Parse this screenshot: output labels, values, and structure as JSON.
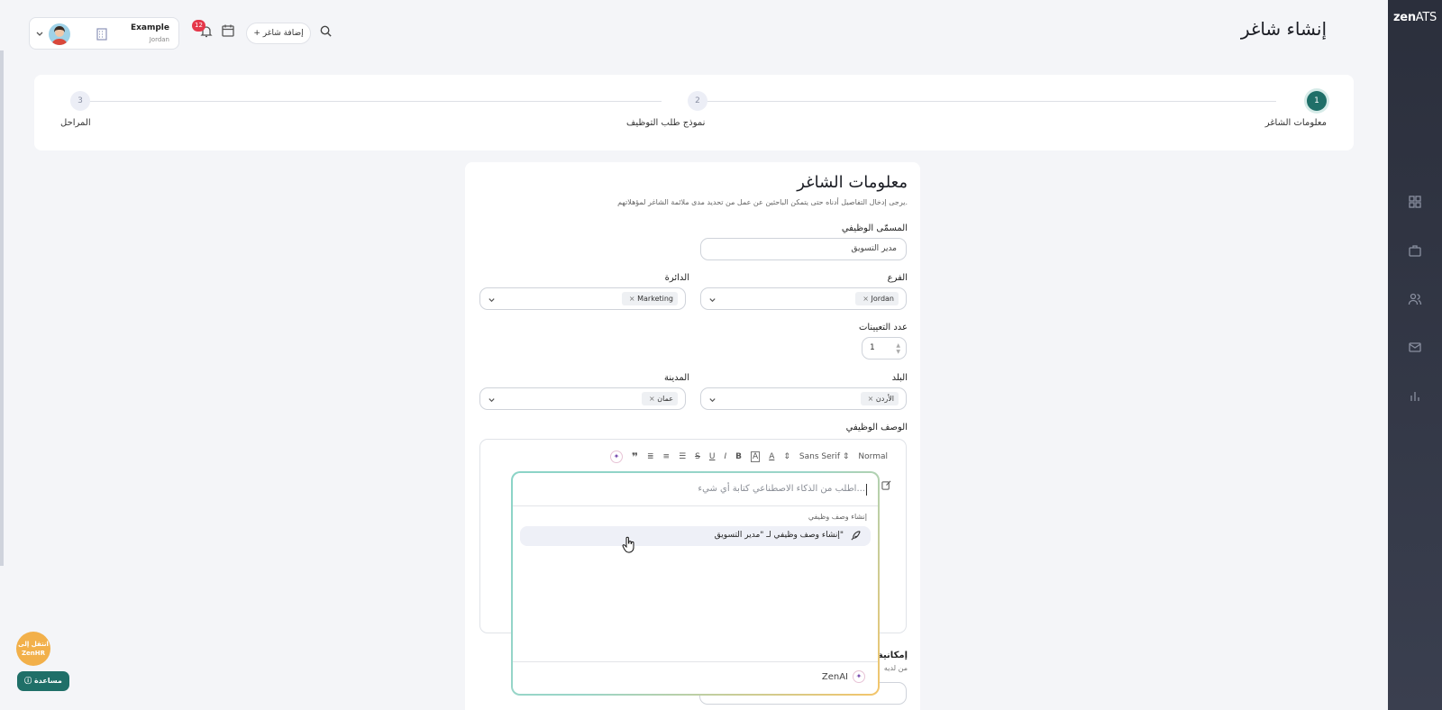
{
  "brand": {
    "zen": "zen",
    "ats": "ATS"
  },
  "header": {
    "title": "إنشاء شاغر",
    "user_name": "Example",
    "user_country": "Jordan",
    "notifications_count": "12",
    "add_job_label": "+ إضافة شاغر"
  },
  "steps": [
    {
      "number": "1",
      "label": "معلومات الشاغر",
      "active": true
    },
    {
      "number": "2",
      "label": "نموذج طلب التوظيف",
      "active": false
    },
    {
      "number": "3",
      "label": "المراحل",
      "active": false
    }
  ],
  "form": {
    "title": "معلومات الشاغر",
    "subtitle": "يرجى إدخال التفاصيل أدناه حتى يتمكن الباحثين عن عمل من تحديد مدى ملائمة الشاغر لمؤهلاتهم.",
    "job_title_label": "المسمّى الوظيفي",
    "job_title_value": "مدير التسويق",
    "branch_label": "الفرع",
    "branch_value": "Jordan",
    "department_label": "الدائرة",
    "department_value": "Marketing",
    "openings_label": "عدد التعيينات",
    "openings_value": "1",
    "country_label": "البلد",
    "country_value": "الأردن",
    "city_label": "المدينة",
    "city_value": "عمان",
    "description_label": "الوصف الوظيفي",
    "toolbar": {
      "size": "Normal",
      "font": "Sans Serif"
    },
    "cut_label": "إمكانية",
    "cut_sub": "من لديه"
  },
  "ai_popup": {
    "placeholder": "اطلب من الذكاء الاصطناعي كتابة أي شيء...",
    "group_label": "إنشاء وصف وظيفي",
    "suggestion": "إنشاء وصف وظيفي لـ \"مدير التسويق\"",
    "footer_label": "ZenAI"
  },
  "floating": {
    "move_label_line1": "انتقل إلى",
    "move_label_line2": "ZenHR",
    "help_label": "مساعدة"
  },
  "colors": {
    "accent": "#1f6f68",
    "sidebar": "#2b2f3c",
    "badge": "#e5374a",
    "move": "#f2b04a"
  }
}
